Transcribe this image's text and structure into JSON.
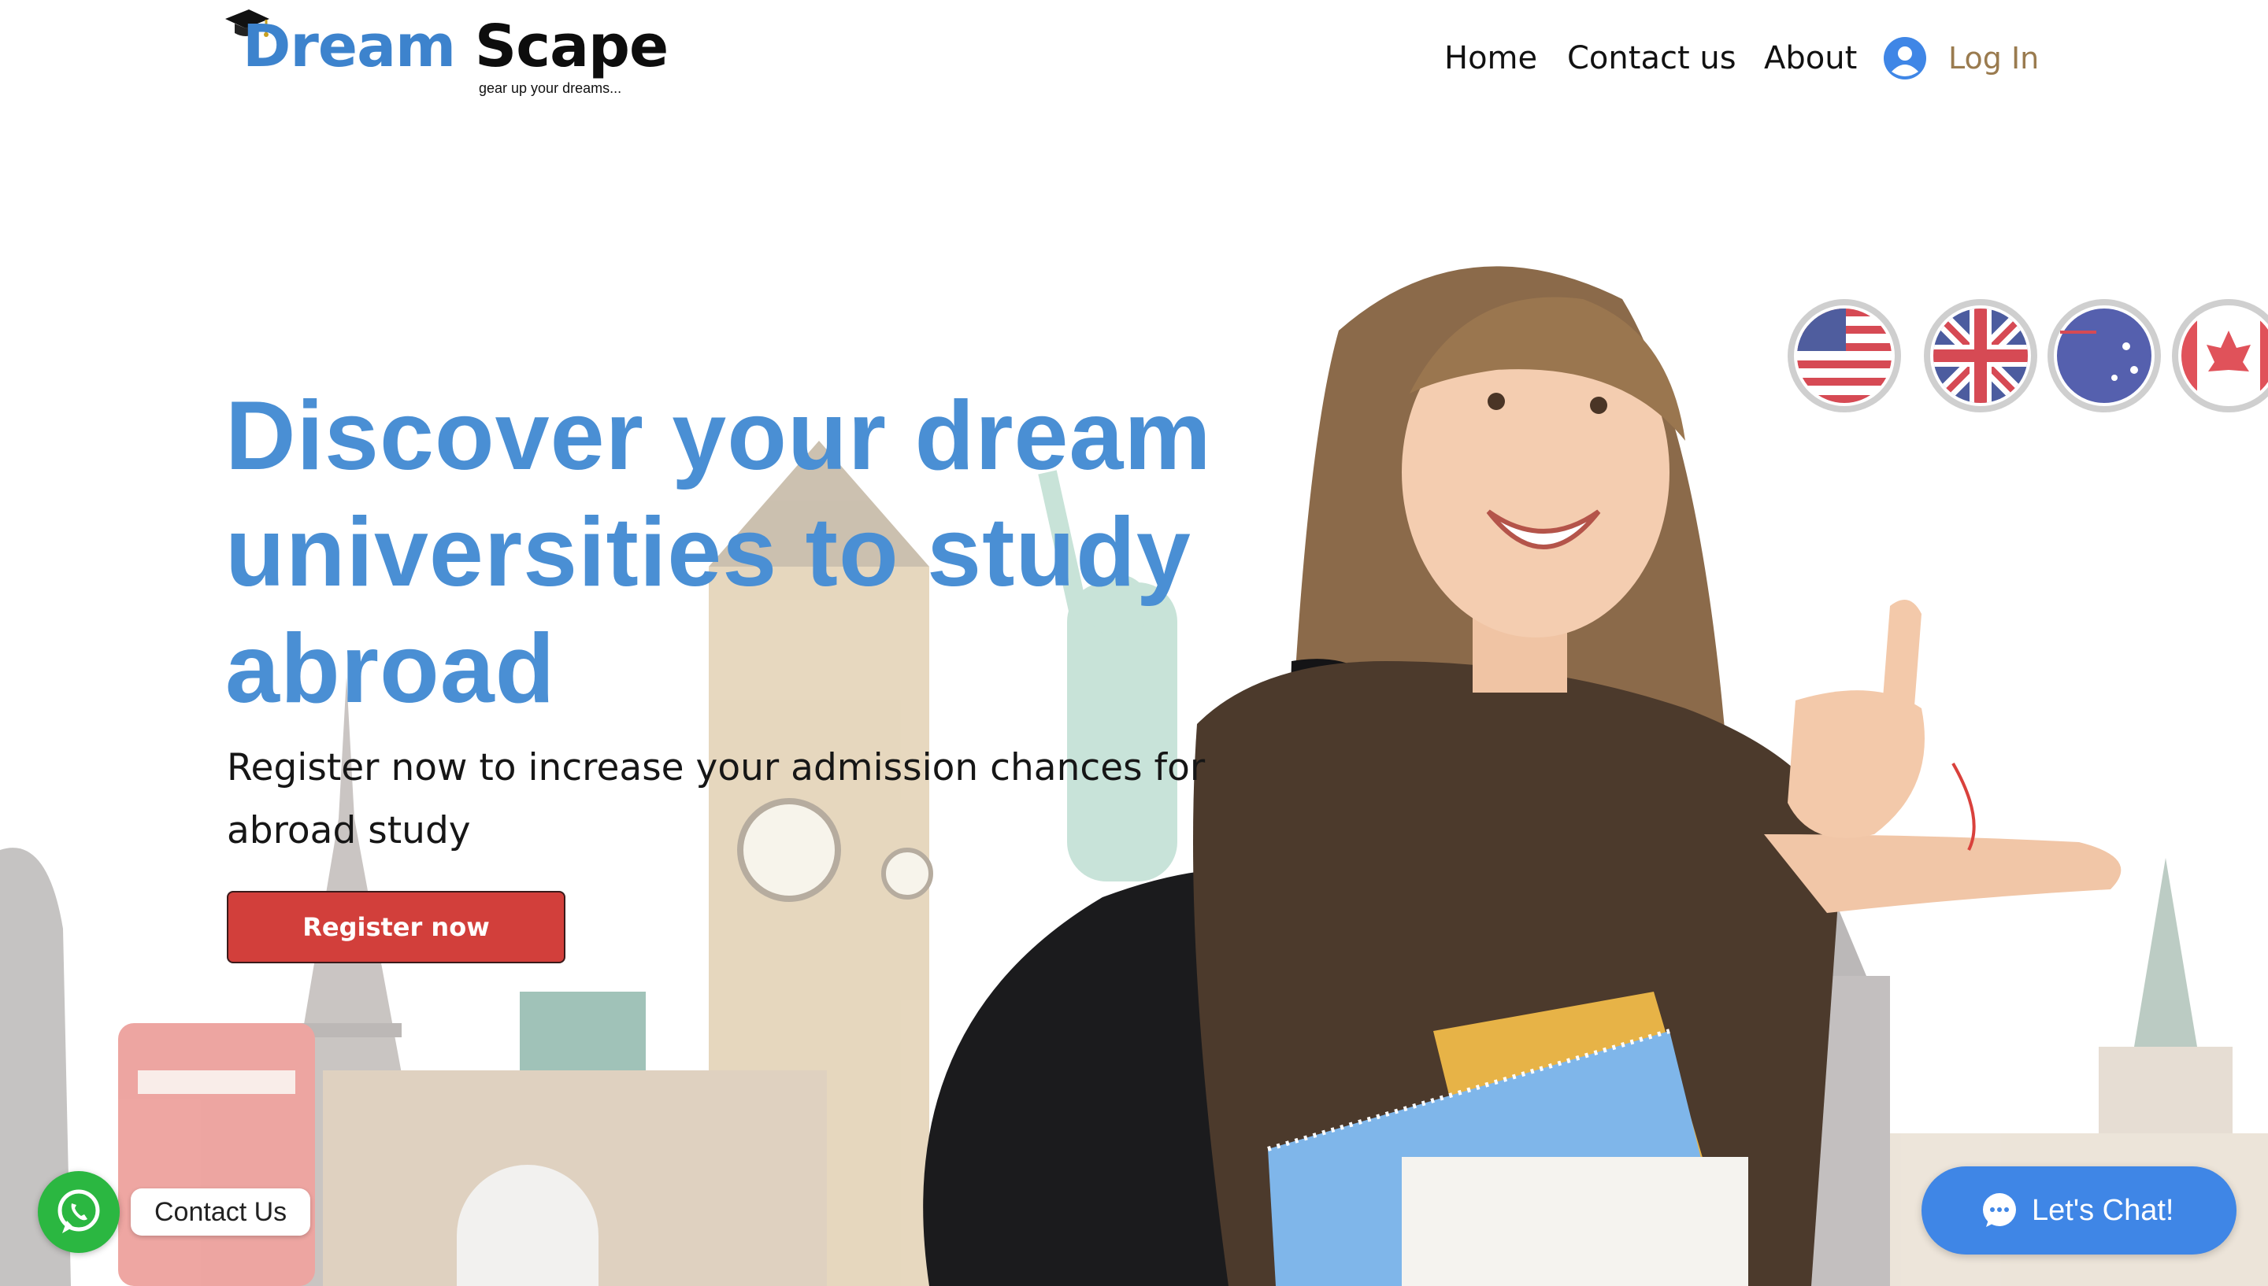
{
  "brand": {
    "name_part1": "Dream",
    "name_part2": "Scape",
    "tagline": "gear up your dreams...",
    "colors": {
      "dream_blue": "#3d83cd",
      "scape_black": "#0d0d0d"
    },
    "icon": "graduation-cap-icon"
  },
  "nav": {
    "items": [
      {
        "label": "Home"
      },
      {
        "label": "Contact us"
      },
      {
        "label": "About"
      }
    ],
    "login": {
      "label": "Log In",
      "icon": "user-avatar-icon",
      "color": "#9a7b4f"
    }
  },
  "hero": {
    "headline": "Discover your dream universities to study abroad",
    "subheadline": "Register now to increase your admission chances for abroad study",
    "cta_label": "Register now",
    "colors": {
      "headline": "#4a8fd4",
      "cta_bg": "#d23f3b"
    },
    "flags": [
      "usa-flag-icon",
      "uk-flag-icon",
      "australia-flag-icon",
      "canada-flag-icon"
    ]
  },
  "widgets": {
    "whatsapp": {
      "label": "Contact Us",
      "icon": "whatsapp-icon",
      "color": "#2bb741"
    },
    "chat": {
      "label": "Let's Chat!",
      "icon": "chat-bubble-icon",
      "color": "#3f86e6"
    }
  }
}
